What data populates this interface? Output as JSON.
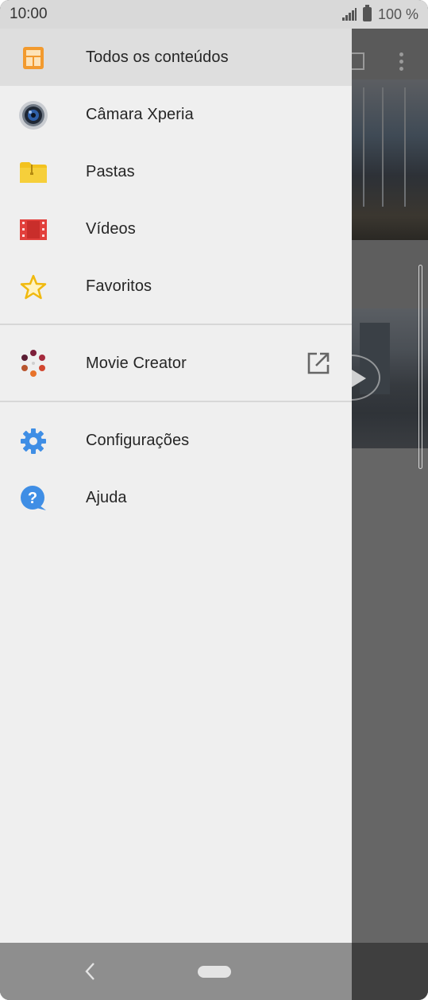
{
  "status_bar": {
    "time": "10:00",
    "battery": "100 %"
  },
  "drawer": {
    "primary_items": [
      {
        "label": "Todos os conteúdos",
        "icon": "all-content-icon",
        "selected": true
      },
      {
        "label": "Câmara Xperia",
        "icon": "camera-icon",
        "selected": false
      },
      {
        "label": "Pastas",
        "icon": "folder-icon",
        "selected": false
      },
      {
        "label": "Vídeos",
        "icon": "video-film-icon",
        "selected": false
      },
      {
        "label": "Favoritos",
        "icon": "star-icon",
        "selected": false
      }
    ],
    "app_items": [
      {
        "label": "Movie Creator",
        "icon": "movie-creator-icon",
        "action_icon": "open-external-icon"
      }
    ],
    "bottom_items": [
      {
        "label": "Configurações",
        "icon": "settings-gear-icon"
      },
      {
        "label": "Ajuda",
        "icon": "help-icon"
      }
    ]
  },
  "colors": {
    "drawer_bg": "#efefef",
    "selected_bg": "#dedede",
    "folder_yellow": "#f3c21e",
    "film_red": "#e2403c",
    "star_gold": "#f0b90f",
    "settings_blue": "#3f8ee5",
    "help_blue": "#3f8ee5"
  }
}
